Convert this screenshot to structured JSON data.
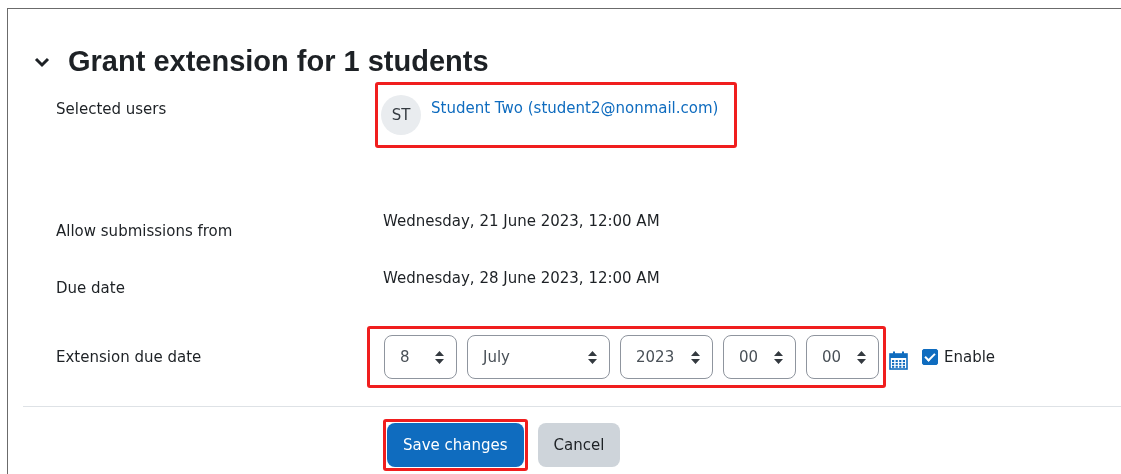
{
  "heading": {
    "title": "Grant extension for 1 students",
    "expanded": true
  },
  "selected_users": {
    "label": "Selected users",
    "highlighted": true,
    "users": [
      {
        "initials": "ST",
        "name": "Student Two (student2@nonmail.com)"
      }
    ]
  },
  "info_rows": [
    {
      "label": "Allow submissions from",
      "value": "Wednesday, 21 June 2023, 12:00 AM"
    },
    {
      "label": "Due date",
      "value": "Wednesday, 28 June 2023, 12:00 AM"
    }
  ],
  "extension_due_date": {
    "label": "Extension due date",
    "highlighted": true,
    "fields": [
      {
        "kind": "day",
        "value": "8"
      },
      {
        "kind": "month",
        "value": "July"
      },
      {
        "kind": "year",
        "value": "2023"
      },
      {
        "kind": "hour",
        "value": "00"
      },
      {
        "kind": "minute",
        "value": "00"
      }
    ],
    "enable": {
      "label": "Enable",
      "checked": true
    }
  },
  "buttons": [
    {
      "kind": "primary",
      "label": "Save changes",
      "highlighted": true
    },
    {
      "kind": "secondary",
      "label": "Cancel",
      "highlighted": false
    }
  ]
}
